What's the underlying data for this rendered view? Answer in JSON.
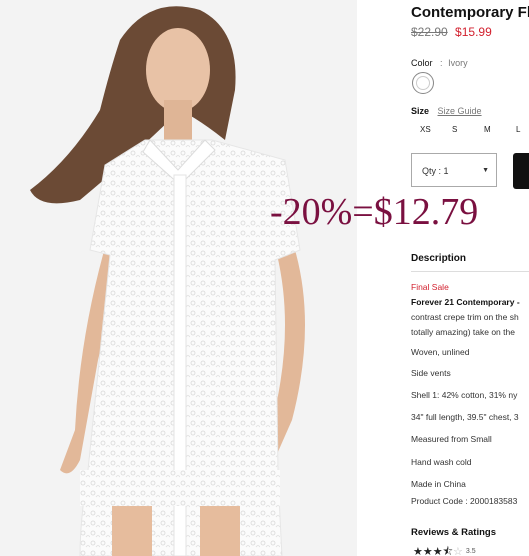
{
  "product": {
    "title": "Contemporary Fl",
    "old_price": "$22.90",
    "sale_price": "$15.99"
  },
  "color": {
    "label": "Color",
    "sep": ":",
    "value": "Ivory"
  },
  "size": {
    "label": "Size",
    "guide": "Size Guide",
    "options": [
      "XS",
      "S",
      "M",
      "L"
    ]
  },
  "quantity": {
    "label": "Qty : 1"
  },
  "description": {
    "heading": "Description",
    "final_sale": "Final Sale",
    "lead": "Forever 21 Contemporary -",
    "lines": [
      "contrast crepe trim on the sh",
      "totally amazing) take on the",
      "Woven, unlined",
      "Side vents",
      "Shell 1: 42% cotton, 31% ny",
      "34\" full length, 39.5\" chest, 3",
      "Measured from Small",
      "Hand wash cold",
      "Made in China",
      "Product Code : 2000183583"
    ]
  },
  "reviews": {
    "heading": "Reviews & Ratings",
    "stars_full": 3,
    "stars_half": 1,
    "stars_empty": 1,
    "rating": "3.5"
  },
  "overlay_text": "-20%=$12.79",
  "colors": {
    "sale": "#d21f2d",
    "overlay": "#7a1040",
    "button": "#111111"
  }
}
